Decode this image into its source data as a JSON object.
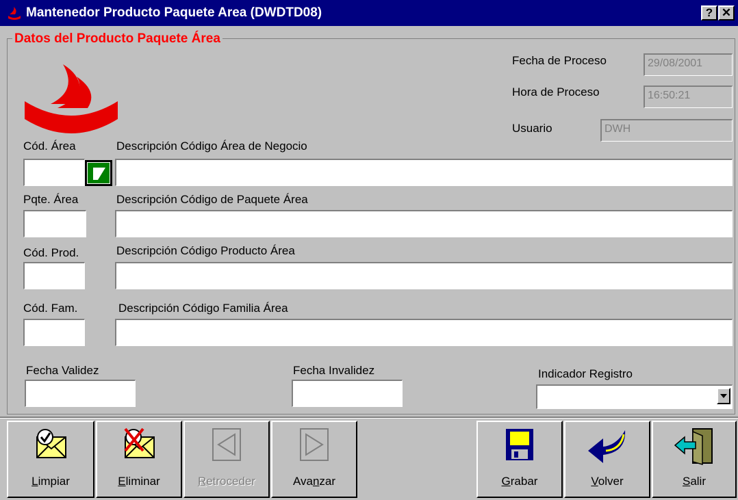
{
  "window": {
    "title": "Mantenedor Producto Paquete Area (DWDTD08)",
    "help_label": "?",
    "close_label": "✕"
  },
  "group": {
    "title": "Datos del Producto Paquete Área"
  },
  "process": {
    "date_label": "Fecha de Proceso",
    "date_value": "29/08/2001",
    "time_label": "Hora de Proceso",
    "time_value": "16:50:21",
    "user_label": "Usuario",
    "user_value": "DWH"
  },
  "fields": {
    "area_code_label": "Cód. Área",
    "area_desc_label": "Descripción Código Área de Negocio",
    "package_label": "Pqte. Área",
    "package_desc_label": "Descripción Código de Paquete Área",
    "product_label": "Cód. Prod.",
    "product_desc_label": "Descripción Código Producto Área",
    "family_label": "Cód. Fam.",
    "family_desc_label": "Descripción Código Familia Área",
    "valid_date_label": "Fecha Validez",
    "invalid_date_label": "Fecha Invalidez",
    "record_indicator_label": "Indicador Registro"
  },
  "buttons": {
    "clear": {
      "label_u": "L",
      "label_rest": "impiar"
    },
    "delete": {
      "label_u": "E",
      "label_rest": "liminar"
    },
    "back": {
      "label_u": "R",
      "label_rest": "etroceder"
    },
    "forward": {
      "label_pre": "Ava",
      "label_u": "n",
      "label_rest": "zar"
    },
    "save": {
      "label_u": "G",
      "label_rest": "rabar"
    },
    "return": {
      "label_u": "V",
      "label_rest": "olver"
    },
    "exit": {
      "label_u": "S",
      "label_rest": "alir"
    }
  },
  "colors": {
    "titlebar": "#000080",
    "group_title": "#ff0000",
    "logo": "#e60000"
  }
}
